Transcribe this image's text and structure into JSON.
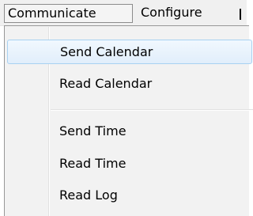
{
  "menubar": {
    "items": [
      {
        "label": "Communicate",
        "active": true
      },
      {
        "label": "Configure",
        "active": false
      },
      {
        "label": "I",
        "active": false
      }
    ]
  },
  "dropdown": {
    "items": [
      {
        "label": "Send Calendar",
        "highlighted": true
      },
      {
        "label": "Read Calendar",
        "highlighted": false
      },
      {
        "label": "Send Time",
        "highlighted": false
      },
      {
        "label": "Read Time",
        "highlighted": false
      },
      {
        "label": "Read Log",
        "highlighted": false
      }
    ]
  },
  "colors": {
    "menu_background": "#f2f2f2",
    "highlight_border": "#a8d1f1",
    "highlight_fill": "#e5f0fb",
    "active_border": "#8c8c8c"
  }
}
